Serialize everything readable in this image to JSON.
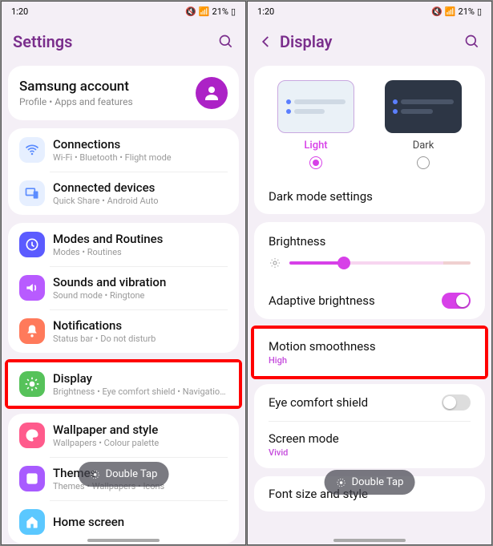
{
  "status": {
    "time": "1:20",
    "battery": "21%"
  },
  "left": {
    "title": "Settings",
    "account": {
      "title": "Samsung account",
      "subtitle": "Profile • Apps and features"
    },
    "groups": [
      {
        "items": [
          {
            "icon": "wifi",
            "color": "#5b8cff",
            "bg": "#e6efff",
            "title": "Connections",
            "subtitle": "Wi-Fi • Bluetooth • Flight mode"
          },
          {
            "icon": "devices",
            "color": "#5b8cff",
            "bg": "#e6efff",
            "title": "Connected devices",
            "subtitle": "Quick Share • Android Auto"
          }
        ]
      },
      {
        "items": [
          {
            "icon": "routine",
            "color": "#fff",
            "bg": "#5b5bff",
            "title": "Modes and Routines",
            "subtitle": "Modes • Routines"
          },
          {
            "icon": "sound",
            "color": "#fff",
            "bg": "#b85bff",
            "title": "Sounds and vibration",
            "subtitle": "Sound mode • Ringtone"
          },
          {
            "icon": "bell",
            "color": "#fff",
            "bg": "#ff7a5b",
            "title": "Notifications",
            "subtitle": "Status bar • Do not disturb"
          }
        ]
      },
      {
        "highlight": true,
        "items": [
          {
            "icon": "sun",
            "color": "#fff",
            "bg": "#56c25a",
            "title": "Display",
            "subtitle": "Brightness • Eye comfort shield • Navigation bar"
          }
        ]
      },
      {
        "items": [
          {
            "icon": "palette",
            "color": "#fff",
            "bg": "#ff5b8c",
            "title": "Wallpaper and style",
            "subtitle": "Wallpapers • Colour palette"
          },
          {
            "icon": "theme",
            "color": "#fff",
            "bg": "#a85bff",
            "title": "Themes",
            "subtitle": "Themes • Wallpapers • Icons"
          },
          {
            "icon": "home",
            "color": "#fff",
            "bg": "#5bc8ff",
            "title": "Home screen",
            "subtitle": ""
          }
        ]
      }
    ],
    "double_tap": "Double Tap"
  },
  "right": {
    "title": "Display",
    "theme": {
      "light": "Light",
      "dark": "Dark",
      "selected": "light"
    },
    "dark_mode": "Dark mode settings",
    "brightness_label": "Brightness",
    "brightness_value": 30,
    "adaptive": {
      "label": "Adaptive brightness",
      "on": true
    },
    "motion": {
      "label": "Motion smoothness",
      "value": "High",
      "highlight": true
    },
    "eye": {
      "label": "Eye comfort shield",
      "on": false
    },
    "screen_mode": {
      "label": "Screen mode",
      "value": "Vivid"
    },
    "font": "Font size and style",
    "double_tap": "Double Tap"
  }
}
